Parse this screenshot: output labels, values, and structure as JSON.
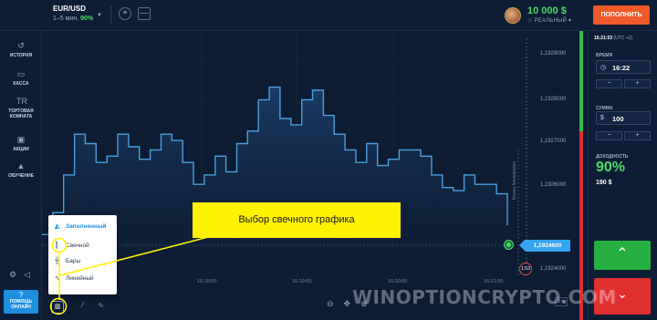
{
  "header": {
    "asset_name": "EUR/USD",
    "asset_range": "1–5 мин,",
    "asset_payout": "90%",
    "balance_amount": "10 000 $",
    "account_type": "☆ РЕАЛЬНЫЙ ▾",
    "deposit_label": "ПОПОЛНИТЬ"
  },
  "sidebar": {
    "items": [
      {
        "label": "ИСТОРИЯ",
        "icon": "history-icon"
      },
      {
        "label": "КАССА",
        "icon": "wallet-icon"
      },
      {
        "label": "ТОРГОВАЯ КОМНАТА",
        "icon": "trading-room-icon"
      },
      {
        "label": "АКЦИИ",
        "icon": "gift-icon"
      },
      {
        "label": "ОБУЧЕНИЕ",
        "icon": "education-icon"
      }
    ],
    "help_icon": "?",
    "help_label_1": "ПОМОЩЬ",
    "help_label_2": "ОНЛАЙН"
  },
  "chart_data": {
    "type": "line",
    "asset": "EUR/USD",
    "y_ticks": [
      "1,1929090",
      "1,1928000",
      "1,1927000",
      "1,1926000",
      "1,1924600",
      "1,1924000"
    ],
    "x_ticks": [
      "16:18:00",
      "16:19:00",
      "16:20:00",
      "16:21:00"
    ],
    "current_price": "1,1924600",
    "timer": "1:53",
    "expiration_label": "Конец блокировки",
    "zoom": "2 м",
    "x": [
      "16:17:37",
      "16:17:42",
      "16:17:47",
      "16:17:52",
      "16:17:57",
      "16:18:02",
      "16:18:07",
      "16:18:12",
      "16:18:17",
      "16:18:22",
      "16:18:27",
      "16:18:32",
      "16:18:37",
      "16:18:42",
      "16:18:47",
      "16:18:52",
      "16:18:57",
      "16:19:02",
      "16:19:07",
      "16:19:12",
      "16:19:17",
      "16:19:22",
      "16:19:27",
      "16:19:32",
      "16:19:37",
      "16:19:42",
      "16:19:47",
      "16:19:52",
      "16:19:57",
      "16:20:02",
      "16:20:07",
      "16:20:12",
      "16:20:17",
      "16:20:22",
      "16:20:27",
      "16:20:32",
      "16:20:37",
      "16:20:42",
      "16:20:47",
      "16:20:52",
      "16:20:57",
      "16:21:02",
      "16:21:07",
      "16:21:12"
    ],
    "values": [
      1.19243,
      1.1925,
      1.19262,
      1.19275,
      1.19272,
      1.19266,
      1.19268,
      1.19275,
      1.19271,
      1.19267,
      1.1927,
      1.19275,
      1.19273,
      1.19266,
      1.19259,
      1.19262,
      1.19268,
      1.19263,
      1.19272,
      1.19276,
      1.19286,
      1.1929,
      1.1928,
      1.19278,
      1.19286,
      1.19289,
      1.19281,
      1.19275,
      1.1927,
      1.19266,
      1.19272,
      1.19265,
      1.19267,
      1.1927,
      1.1927,
      1.19268,
      1.19262,
      1.19258,
      1.19257,
      1.19262,
      1.19259,
      1.19259,
      1.19256,
      1.19246
    ],
    "ylim": [
      1.1923,
      1.19305
    ]
  },
  "chart_menu": {
    "items": [
      {
        "label": "Заполненный",
        "icon": "area-chart-icon",
        "active": true
      },
      {
        "label": "Свечной",
        "icon": "candlestick-icon",
        "active": false
      },
      {
        "label": "Бары",
        "icon": "bars-chart-icon",
        "active": false
      },
      {
        "label": "Линейный",
        "icon": "line-chart-icon",
        "active": false
      }
    ]
  },
  "annotation": {
    "text": "Выбор свечного графика"
  },
  "trade_panel": {
    "server_time": "16:21:53",
    "timezone": "(UTC +2)",
    "time_label": "ВРЕМЯ",
    "time_value": "16:22",
    "amount_label": "СУММА",
    "amount_currency": "$",
    "amount_value": "100",
    "yield_label": "ДОХОДНОСТЬ",
    "yield_percent": "90%",
    "yield_amount": "190 $",
    "minus": "−",
    "plus": "+",
    "up_arrow": "⌃",
    "down_arrow": "⌄"
  },
  "watermark": "WINOPTIONCRYPTO.COM",
  "colors": {
    "background": "#0d1c33",
    "chart_line": "#4a9fe0",
    "up": "#27b042",
    "down": "#e03030",
    "deposit": "#f0592a",
    "annotation": "#fff200"
  }
}
